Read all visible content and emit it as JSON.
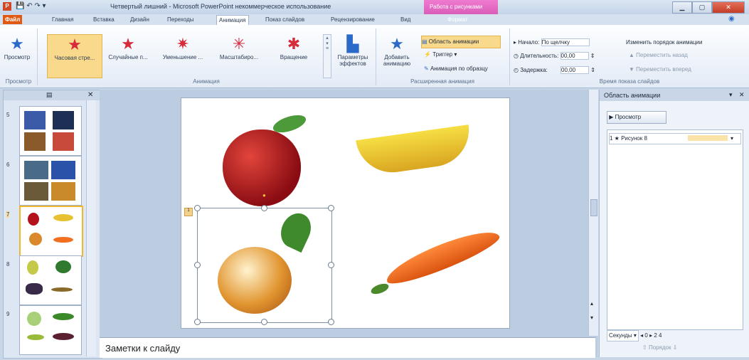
{
  "window": {
    "title": "Четвертый лишний - Microsoft PowerPoint некоммерческое использование",
    "context_tab": "Работа с рисунками"
  },
  "tabs": [
    "Файл",
    "Главная",
    "Вставка",
    "Дизайн",
    "Переходы",
    "Анимация",
    "Показ слайдов",
    "Рецензирование",
    "Вид",
    "Формат"
  ],
  "ribbon": {
    "preview_label": "Просмотр",
    "effects": [
      "Часовая стре...",
      "Случайные п...",
      "Уменьшение ...",
      "Масштабиро...",
      "Вращение"
    ],
    "effect_params": "Параметры эффектов",
    "add_animation": "Добавить анимацию",
    "anim_pane": "Область анимации",
    "trigger": "Триггер",
    "anim_by_sample": "Анимация по образцу",
    "start_label": "Начало:",
    "start_value": "По щелчку",
    "duration_label": "Длительность:",
    "duration_value": "00,00",
    "delay_label": "Задержка:",
    "delay_value": "00,00",
    "change_order": "Изменить порядок анимации",
    "move_earlier": "Переместить назад",
    "move_later": "Переместить вперед",
    "groups": [
      "Просмотр",
      "Анимация",
      "Расширенная анимация",
      "Время показа слайдов"
    ]
  },
  "slides": [
    {
      "num": "5"
    },
    {
      "num": "6"
    },
    {
      "num": "7"
    },
    {
      "num": "8"
    },
    {
      "num": "9"
    }
  ],
  "notes_placeholder": "Заметки к слайду",
  "anim_pane": {
    "title": "Область анимации",
    "play_button": "Просмотр",
    "item": "1 ★ Рисунок 8",
    "seconds": "Секунды",
    "page": "0",
    "page2": "2",
    "page3": "4",
    "reorder": "Порядок"
  },
  "colors": {
    "ribbon_selected": "#f9d98b",
    "file_tab": "#e15a14",
    "context_tab": "#c94aa8"
  }
}
